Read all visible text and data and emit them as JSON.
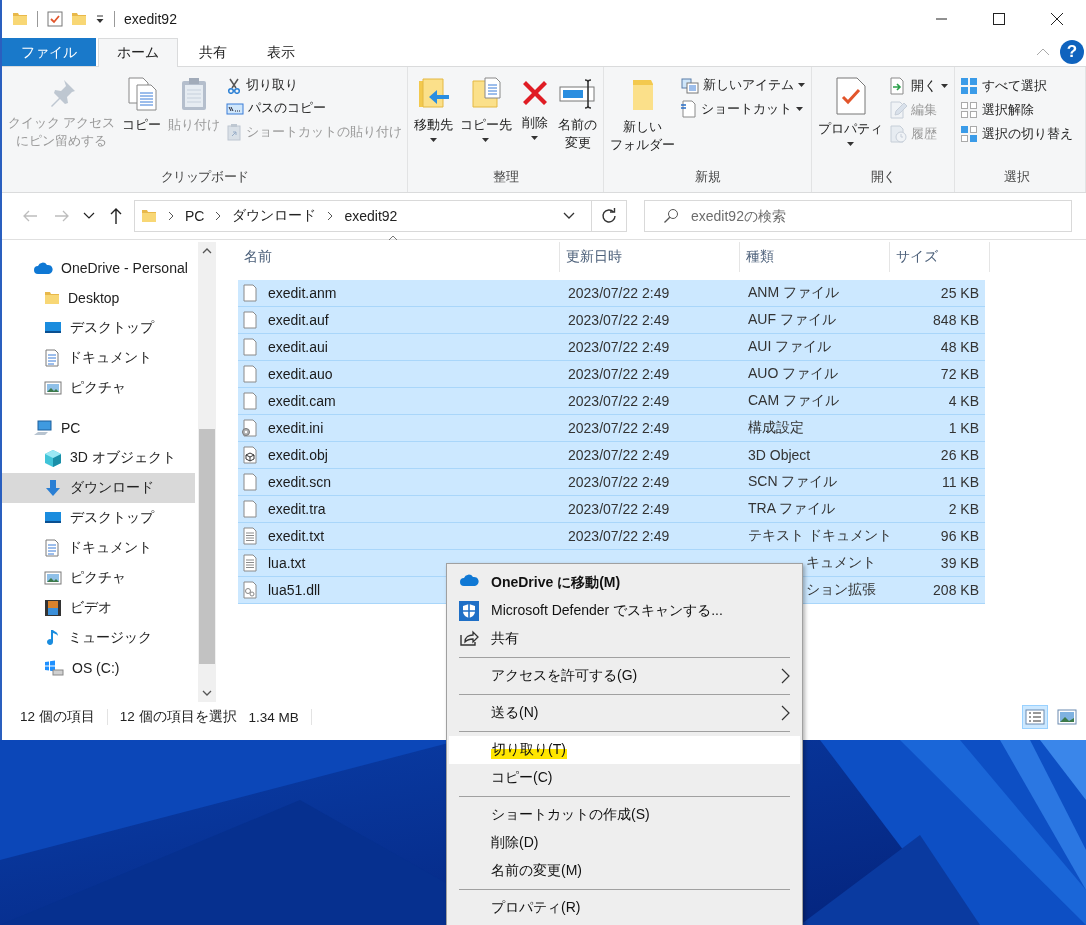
{
  "window": {
    "title": "exedit92",
    "help": "?"
  },
  "ribbon_tabs": [
    {
      "label": "ファイル",
      "kind": "file",
      "selected": false
    },
    {
      "label": "ホーム",
      "kind": "tab",
      "selected": true
    },
    {
      "label": "共有",
      "kind": "tab",
      "selected": false
    },
    {
      "label": "表示",
      "kind": "tab",
      "selected": false
    }
  ],
  "ribbon_groups": [
    {
      "title": "クリップボード",
      "items": [
        {
          "lines": [
            "クイック アクセス",
            "にピン留めする"
          ],
          "kind": "large",
          "disabled": true,
          "dropdown": false
        },
        {
          "label": "コピー",
          "kind": "large",
          "disabled": false,
          "dropdown": false
        },
        {
          "label": "貼り付け",
          "kind": "large",
          "disabled": true,
          "dropdown": false
        },
        {
          "label": "切り取り",
          "kind": "small",
          "disabled": false,
          "dropdown": false
        },
        {
          "label": "パスのコピー",
          "kind": "small",
          "disabled": false,
          "dropdown": false
        },
        {
          "label": "ショートカットの貼り付け",
          "kind": "small",
          "disabled": true,
          "dropdown": false
        }
      ]
    },
    {
      "title": "整理",
      "items": [
        {
          "label": "移動先",
          "kind": "large",
          "disabled": false,
          "dropdown": true
        },
        {
          "label": "コピー先",
          "kind": "large",
          "disabled": false,
          "dropdown": true
        },
        {
          "label": "削除",
          "kind": "large",
          "disabled": false,
          "dropdown": true
        },
        {
          "lines": [
            "名前の",
            "変更"
          ],
          "kind": "large",
          "disabled": false,
          "dropdown": false
        }
      ]
    },
    {
      "title": "新規",
      "items": [
        {
          "lines": [
            "新しい",
            "フォルダー"
          ],
          "kind": "large",
          "disabled": false,
          "dropdown": false
        },
        {
          "label": "新しいアイテム",
          "kind": "small",
          "disabled": false,
          "dropdown": true
        },
        {
          "label": "ショートカット",
          "kind": "small",
          "disabled": false,
          "dropdown": true
        }
      ]
    },
    {
      "title": "開く",
      "items": [
        {
          "label": "プロパティ",
          "kind": "large",
          "disabled": false,
          "dropdown": true
        },
        {
          "label": "開く",
          "kind": "small",
          "disabled": false,
          "dropdown": true
        },
        {
          "label": "編集",
          "kind": "small",
          "disabled": true,
          "dropdown": false
        },
        {
          "label": "履歴",
          "kind": "small",
          "disabled": true,
          "dropdown": false
        }
      ]
    },
    {
      "title": "選択",
      "items": [
        {
          "label": "すべて選択",
          "kind": "small",
          "disabled": false,
          "dropdown": false
        },
        {
          "label": "選択解除",
          "kind": "small",
          "disabled": false,
          "dropdown": false
        },
        {
          "label": "選択の切り替え",
          "kind": "small",
          "disabled": false,
          "dropdown": false
        }
      ]
    }
  ],
  "nav_buttons": [
    {
      "kind": "back",
      "disabled": true
    },
    {
      "kind": "forward",
      "disabled": true
    },
    {
      "kind": "recent",
      "disabled": false
    },
    {
      "kind": "up",
      "disabled": false
    }
  ],
  "breadcrumb": [
    "PC",
    "ダウンロード",
    "exedit92"
  ],
  "search": {
    "placeholder": "exedit92の検索"
  },
  "navigation": [
    {
      "label": "OneDrive - Personal",
      "selected": false,
      "children": [
        {
          "label": "Desktop",
          "selected": false
        },
        {
          "label": "デスクトップ",
          "selected": false
        },
        {
          "label": "ドキュメント",
          "selected": false
        },
        {
          "label": "ピクチャ",
          "selected": false
        }
      ]
    },
    {
      "label": "PC",
      "selected": false,
      "children": [
        {
          "label": "3D オブジェクト",
          "selected": false
        },
        {
          "label": "ダウンロード",
          "selected": true
        },
        {
          "label": "デスクトップ",
          "selected": false
        },
        {
          "label": "ドキュメント",
          "selected": false
        },
        {
          "label": "ピクチャ",
          "selected": false
        },
        {
          "label": "ビデオ",
          "selected": false
        },
        {
          "label": "ミュージック",
          "selected": false
        },
        {
          "label": "OS (C:)",
          "selected": false
        }
      ]
    }
  ],
  "files": {
    "columns": [
      "名前",
      "更新日時",
      "種類",
      "サイズ"
    ],
    "rows": [
      {
        "name": "exedit.anm",
        "kind": "file",
        "modified": "2023/07/22 2:49",
        "type": "ANM ファイル",
        "size": "25 KB",
        "selected": true
      },
      {
        "name": "exedit.auf",
        "kind": "file",
        "modified": "2023/07/22 2:49",
        "type": "AUF ファイル",
        "size": "848 KB",
        "selected": true
      },
      {
        "name": "exedit.aui",
        "kind": "file",
        "modified": "2023/07/22 2:49",
        "type": "AUI ファイル",
        "size": "48 KB",
        "selected": true
      },
      {
        "name": "exedit.auo",
        "kind": "file",
        "modified": "2023/07/22 2:49",
        "type": "AUO ファイル",
        "size": "72 KB",
        "selected": true
      },
      {
        "name": "exedit.cam",
        "kind": "file",
        "modified": "2023/07/22 2:49",
        "type": "CAM ファイル",
        "size": "4 KB",
        "selected": true
      },
      {
        "name": "exedit.ini",
        "kind": "settings",
        "modified": "2023/07/22 2:49",
        "type": "構成設定",
        "size": "1 KB",
        "selected": true
      },
      {
        "name": "exedit.obj",
        "kind": "object3d",
        "modified": "2023/07/22 2:49",
        "type": "3D Object",
        "size": "26 KB",
        "selected": true
      },
      {
        "name": "exedit.scn",
        "kind": "file",
        "modified": "2023/07/22 2:49",
        "type": "SCN ファイル",
        "size": "11 KB",
        "selected": true
      },
      {
        "name": "exedit.tra",
        "kind": "file",
        "modified": "2023/07/22 2:49",
        "type": "TRA ファイル",
        "size": "2 KB",
        "selected": true
      },
      {
        "name": "exedit.txt",
        "kind": "text",
        "modified": "2023/07/22 2:49",
        "type": "テキスト ドキュメント",
        "size": "96 KB",
        "selected": true
      },
      {
        "name": "lua.txt",
        "kind": "text",
        "type": "キュメント",
        "size": "39 KB",
        "selected": true
      },
      {
        "name": "lua51.dll",
        "kind": "library",
        "type": "ション拡張",
        "size": "208 KB",
        "selected": true
      }
    ]
  },
  "status_bar": {
    "item_count": "12 個の項目",
    "selection": "12 個の項目を選択",
    "selection_size": "1.34 MB",
    "views": [
      {
        "kind": "details",
        "selected": true
      },
      {
        "kind": "large_icons",
        "selected": false
      }
    ]
  },
  "context_menu": {
    "items": [
      {
        "kind": "item",
        "label": "OneDrive に移動(M)",
        "bold": true,
        "submenu": false,
        "highlighted": false
      },
      {
        "kind": "item",
        "label": "Microsoft Defender でスキャンする...",
        "bold": false,
        "submenu": false,
        "highlighted": false
      },
      {
        "kind": "item",
        "label": "共有",
        "bold": false,
        "submenu": false,
        "highlighted": false
      },
      {
        "kind": "separator"
      },
      {
        "kind": "item",
        "label": "アクセスを許可する(G)",
        "bold": false,
        "submenu": true,
        "highlighted": false
      },
      {
        "kind": "separator"
      },
      {
        "kind": "item",
        "label": "送る(N)",
        "bold": false,
        "submenu": true,
        "highlighted": false
      },
      {
        "kind": "separator"
      },
      {
        "kind": "item",
        "label": "切り取り(T)",
        "bold": false,
        "submenu": false,
        "highlighted": true
      },
      {
        "kind": "item",
        "label": "コピー(C)",
        "bold": false,
        "submenu": false,
        "highlighted": false
      },
      {
        "kind": "separator"
      },
      {
        "kind": "item",
        "label": "ショートカットの作成(S)",
        "bold": false,
        "submenu": false,
        "highlighted": false
      },
      {
        "kind": "item",
        "label": "削除(D)",
        "bold": false,
        "submenu": false,
        "highlighted": false
      },
      {
        "kind": "item",
        "label": "名前の変更(M)",
        "bold": false,
        "submenu": false,
        "highlighted": false
      },
      {
        "kind": "separator"
      },
      {
        "kind": "item",
        "label": "プロパティ(R)",
        "bold": false,
        "submenu": false,
        "highlighted": false
      }
    ]
  }
}
